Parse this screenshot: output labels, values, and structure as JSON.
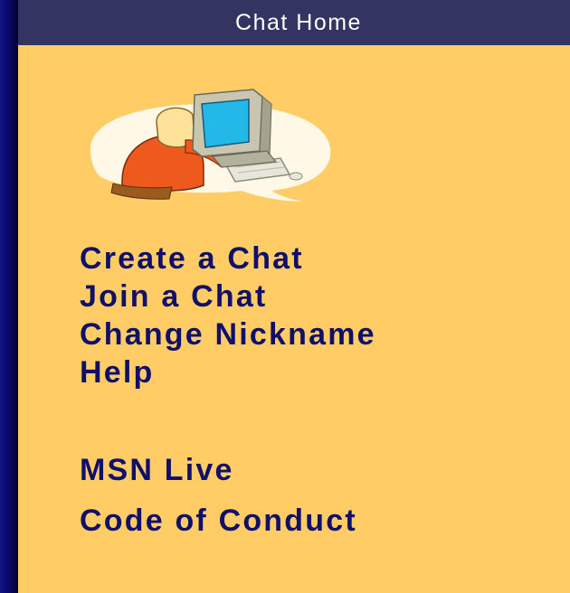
{
  "window": {
    "title": "Chat Home"
  },
  "illustration": {
    "icon": "person-at-computer-icon"
  },
  "links": [
    {
      "label": "Create a Chat"
    },
    {
      "label": "Join a Chat"
    },
    {
      "label": "Change Nickname"
    },
    {
      "label": "Help"
    },
    {
      "label": "MSN Live"
    },
    {
      "label": "Code of Conduct"
    }
  ],
  "colors": {
    "panel_background": "#ffcc66",
    "title_bar": "#343462",
    "link_text": "#10106a",
    "page_background": "#02022a"
  }
}
